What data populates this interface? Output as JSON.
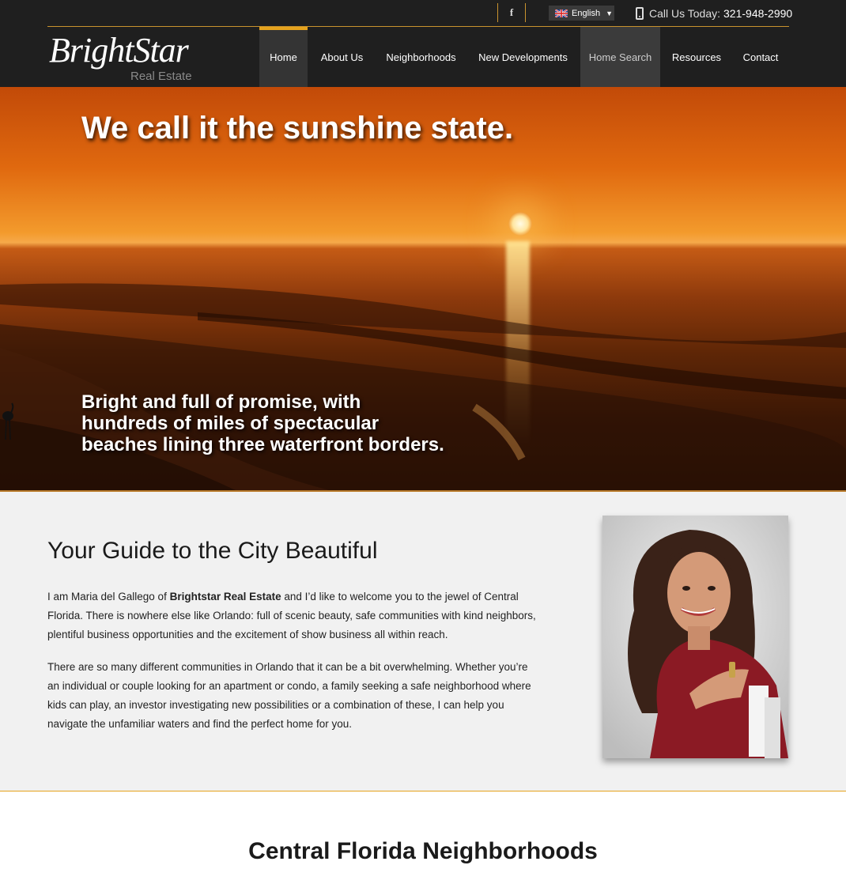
{
  "header": {
    "social": {
      "facebook_label": "f"
    },
    "language": {
      "selected": "English"
    },
    "phone": {
      "label": "Call Us Today:",
      "number": "321-948-2990"
    },
    "logo": {
      "script": "BrightStar",
      "sub": "Real Estate"
    },
    "nav": [
      {
        "label": "Home"
      },
      {
        "label": "About Us"
      },
      {
        "label": "Neighborhoods"
      },
      {
        "label": "New Developments"
      },
      {
        "label": "Home Search"
      },
      {
        "label": "Resources"
      },
      {
        "label": "Contact"
      }
    ],
    "accent_color": "#e5a31d"
  },
  "hero": {
    "title": "We call it the sunshine state.",
    "subtitle_lines": [
      "Bright and full of promise, with",
      "hundreds of miles of spectacular",
      "beaches lining three waterfront borders."
    ]
  },
  "about": {
    "heading": "Your Guide to the City Beautiful",
    "p1_before": "I am Maria del Gallego of ",
    "p1_bold": "Brightstar Real Estate",
    "p1_after": " and I’d like to welcome you to the jewel of Central Florida. There is nowhere else like Orlando: full of scenic beauty, safe communities with kind neighbors, plentiful business opportunities and the excitement of show business all within reach.",
    "p2": "There are so many different communities in Orlando that it can be a bit overwhelming. Whether you’re an individual or couple looking for an apartment or condo, a family seeking a safe neighborhood where kids can play, an investor investigating new possibilities or a combination of these, I can help you navigate the unfamiliar waters and find the perfect home for you."
  },
  "neighborhoods": {
    "heading": "Central Florida Neighborhoods"
  }
}
